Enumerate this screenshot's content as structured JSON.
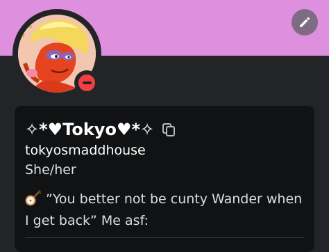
{
  "profile": {
    "banner_color": "#de8fde",
    "display_name": "✧*♥Tokyo♥*✧",
    "username": "tokyosmaddhouse",
    "pronouns": "She/her",
    "bio": "”You better not be cunty Wander when I get back” Me asf:",
    "bio_emoji": "banjo-emoji",
    "status": "do-not-disturb",
    "status_color": "#f23f43"
  },
  "icons": {
    "edit": "pencil-icon",
    "copy": "copy-icon"
  }
}
